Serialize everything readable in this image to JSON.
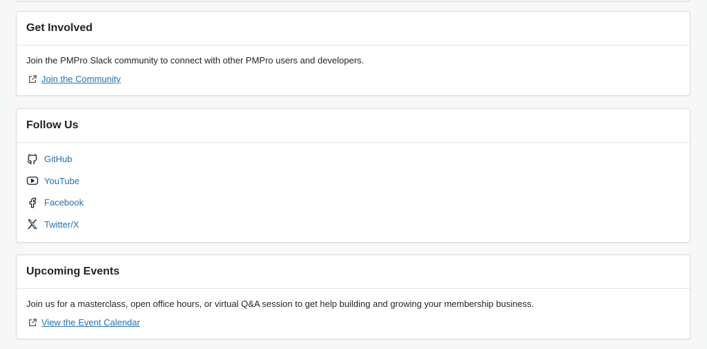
{
  "get_involved": {
    "title": "Get Involved",
    "description": "Join the PMPro Slack community to connect with other PMPro users and developers.",
    "link_label": "Join the Community",
    "link_icon": "external-link-icon"
  },
  "follow_us": {
    "title": "Follow Us",
    "items": [
      {
        "label": "GitHub",
        "icon": "github-icon"
      },
      {
        "label": "YouTube",
        "icon": "youtube-icon"
      },
      {
        "label": "Facebook",
        "icon": "facebook-icon"
      },
      {
        "label": "Twitter/X",
        "icon": "x-twitter-icon"
      }
    ]
  },
  "upcoming_events": {
    "title": "Upcoming Events",
    "description": "Join us for a masterclass, open office hours, or virtual Q&A session to get help building and growing your membership business.",
    "link_label": "View the Event Calendar",
    "link_icon": "external-link-icon"
  },
  "colors": {
    "background": "#f6f7f7",
    "card": "#ffffff",
    "border": "#dcdcde",
    "link": "#2271b1",
    "text": "#1d2327"
  }
}
